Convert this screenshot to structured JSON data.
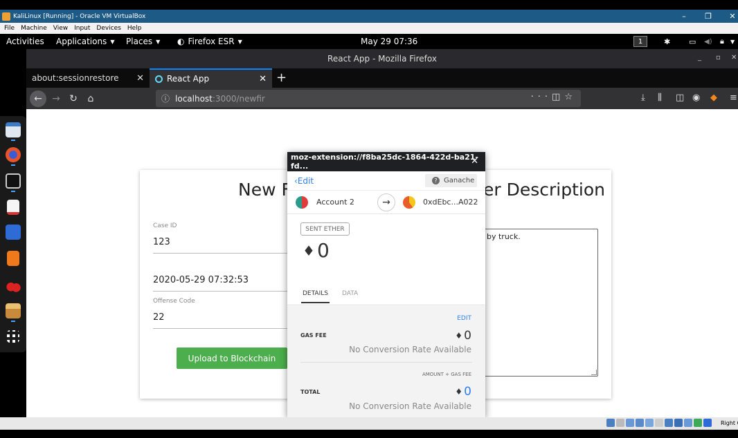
{
  "vbox": {
    "title": "KaliLinux [Running] - Oracle VM VirtualBox",
    "menu": [
      "File",
      "Machine",
      "View",
      "Input",
      "Devices",
      "Help"
    ]
  },
  "gnome": {
    "activities": "Activities",
    "applications": "Applications",
    "places": "Places",
    "firefox": "Firefox ESR",
    "clock": "May 29  07:36",
    "workspace": "1"
  },
  "firefox": {
    "window_title": "React App - Mozilla Firefox",
    "tabs": [
      {
        "label": "about:sessionrestore"
      },
      {
        "label": "React App"
      }
    ],
    "url_host": "localhost",
    "url_path": ":3000/newfir"
  },
  "form": {
    "title_left": "New F",
    "title_right": "er Description",
    "case_id_label": "Case ID",
    "case_id_value": "123",
    "date_value": "2020-05-29 07:32:53",
    "offense_label": "Offense Code",
    "offense_value": "22",
    "upload_label": "Upload to Blockchain",
    "description_text": "by truck."
  },
  "metamask": {
    "header": "moz-extension://f8ba25dc-1864-422d-ba21-fd...",
    "edit": "Edit",
    "network": "Ganache",
    "from_account": "Account 2",
    "to_account": "0xdEbc...A022",
    "badge": "SENT ETHER",
    "amount": "0",
    "tab_details": "DETAILS",
    "tab_data": "DATA",
    "edit_gas": "EDIT",
    "gas_fee_label": "GAS FEE",
    "gas_fee_value": "0",
    "no_rate_1": "No Conversion Rate Available",
    "amount_gas_hint": "AMOUNT + GAS FEE",
    "total_label": "TOTAL",
    "total_value": "0",
    "no_rate_2": "No Conversion Rate Available"
  },
  "statusbar": {
    "host_key": "Right C"
  },
  "colors": {
    "firefox_dark": "#323234",
    "accent_blue": "#0a84ff",
    "upload_green": "#4cae4c",
    "metamask_link": "#2f80ed",
    "vbox_blue": "#1d5a86"
  }
}
